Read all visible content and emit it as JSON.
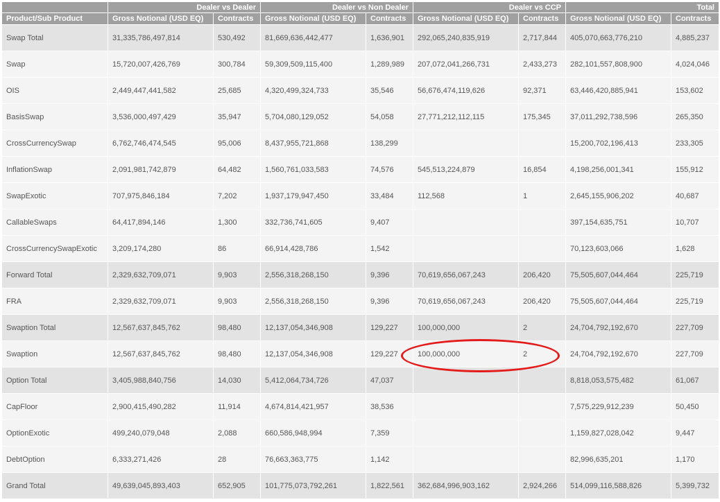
{
  "header": {
    "groups": [
      "",
      "Dealer vs Dealer",
      "Dealer vs Non Dealer",
      "Dealer vs CCP",
      "Total"
    ],
    "columns": [
      "Product/Sub Product",
      "Gross Notional (USD EQ)",
      "Contracts",
      "Gross Notional (USD EQ)",
      "Contracts",
      "Gross Notional (USD EQ)",
      "Contracts",
      "Gross Notional (USD EQ)",
      "Contracts"
    ]
  },
  "rows": [
    {
      "kind": "total",
      "cells": [
        "Swap Total",
        "31,335,786,497,814",
        "530,492",
        "81,669,636,442,477",
        "1,636,901",
        "292,065,240,835,919",
        "2,717,844",
        "405,070,663,776,210",
        "4,885,237"
      ]
    },
    {
      "kind": "detail",
      "cells": [
        "Swap",
        "15,720,007,426,769",
        "300,784",
        "59,309,509,115,400",
        "1,289,989",
        "207,072,041,266,731",
        "2,433,273",
        "282,101,557,808,900",
        "4,024,046"
      ]
    },
    {
      "kind": "detail",
      "cells": [
        "OIS",
        "2,449,447,441,582",
        "25,685",
        "4,320,499,324,733",
        "35,546",
        "56,676,474,119,626",
        "92,371",
        "63,446,420,885,941",
        "153,602"
      ]
    },
    {
      "kind": "detail",
      "cells": [
        "BasisSwap",
        "3,536,000,497,429",
        "35,947",
        "5,704,080,129,052",
        "54,058",
        "27,771,212,112,115",
        "175,345",
        "37,011,292,738,596",
        "265,350"
      ]
    },
    {
      "kind": "detail",
      "cells": [
        "CrossCurrencySwap",
        "6,762,746,474,545",
        "95,006",
        "8,437,955,721,868",
        "138,299",
        "",
        "",
        "15,200,702,196,413",
        "233,305"
      ]
    },
    {
      "kind": "detail",
      "cells": [
        "InflationSwap",
        "2,091,981,742,879",
        "64,482",
        "1,560,761,033,583",
        "74,576",
        "545,513,224,879",
        "16,854",
        "4,198,256,001,341",
        "155,912"
      ]
    },
    {
      "kind": "detail",
      "cells": [
        "SwapExotic",
        "707,975,846,184",
        "7,202",
        "1,937,179,947,450",
        "33,484",
        "112,568",
        "1",
        "2,645,155,906,202",
        "40,687"
      ]
    },
    {
      "kind": "detail",
      "cells": [
        "CallableSwaps",
        "64,417,894,146",
        "1,300",
        "332,736,741,605",
        "9,407",
        "",
        "",
        "397,154,635,751",
        "10,707"
      ]
    },
    {
      "kind": "detail",
      "cells": [
        "CrossCurrencySwapExotic",
        "3,209,174,280",
        "86",
        "66,914,428,786",
        "1,542",
        "",
        "",
        "70,123,603,066",
        "1,628"
      ]
    },
    {
      "kind": "total",
      "cells": [
        "Forward Total",
        "2,329,632,709,071",
        "9,903",
        "2,556,318,268,150",
        "9,396",
        "70,619,656,067,243",
        "206,420",
        "75,505,607,044,464",
        "225,719"
      ]
    },
    {
      "kind": "detail",
      "cells": [
        "FRA",
        "2,329,632,709,071",
        "9,903",
        "2,556,318,268,150",
        "9,396",
        "70,619,656,067,243",
        "206,420",
        "75,505,607,044,464",
        "225,719"
      ]
    },
    {
      "kind": "total",
      "cells": [
        "Swaption Total",
        "12,567,637,845,762",
        "98,480",
        "12,137,054,346,908",
        "129,227",
        "100,000,000",
        "2",
        "24,704,792,192,670",
        "227,709"
      ]
    },
    {
      "kind": "detail",
      "cells": [
        "Swaption",
        "12,567,637,845,762",
        "98,480",
        "12,137,054,346,908",
        "129,227",
        "100,000,000",
        "2",
        "24,704,792,192,670",
        "227,709"
      ]
    },
    {
      "kind": "total",
      "cells": [
        "Option Total",
        "3,405,988,840,756",
        "14,030",
        "5,412,064,734,726",
        "47,037",
        "",
        "",
        "8,818,053,575,482",
        "61,067"
      ]
    },
    {
      "kind": "detail",
      "cells": [
        "CapFloor",
        "2,900,415,490,282",
        "11,914",
        "4,674,814,421,957",
        "38,536",
        "",
        "",
        "7,575,229,912,239",
        "50,450"
      ]
    },
    {
      "kind": "detail",
      "cells": [
        "OptionExotic",
        "499,240,079,048",
        "2,088",
        "660,586,948,994",
        "7,359",
        "",
        "",
        "1,159,827,028,042",
        "9,447"
      ]
    },
    {
      "kind": "detail",
      "cells": [
        "DebtOption",
        "6,333,271,426",
        "28",
        "76,663,363,775",
        "1,142",
        "",
        "",
        "82,996,635,201",
        "1,170"
      ]
    },
    {
      "kind": "total",
      "cells": [
        "Grand Total",
        "49,639,045,893,403",
        "652,905",
        "101,775,073,792,261",
        "1,822,561",
        "362,684,996,903,162",
        "2,924,266",
        "514,099,116,588,826",
        "5,399,732"
      ]
    }
  ],
  "highlight": {
    "color": "#e41b1b",
    "row_label": "Swaption",
    "group": "Dealer vs CCP"
  }
}
